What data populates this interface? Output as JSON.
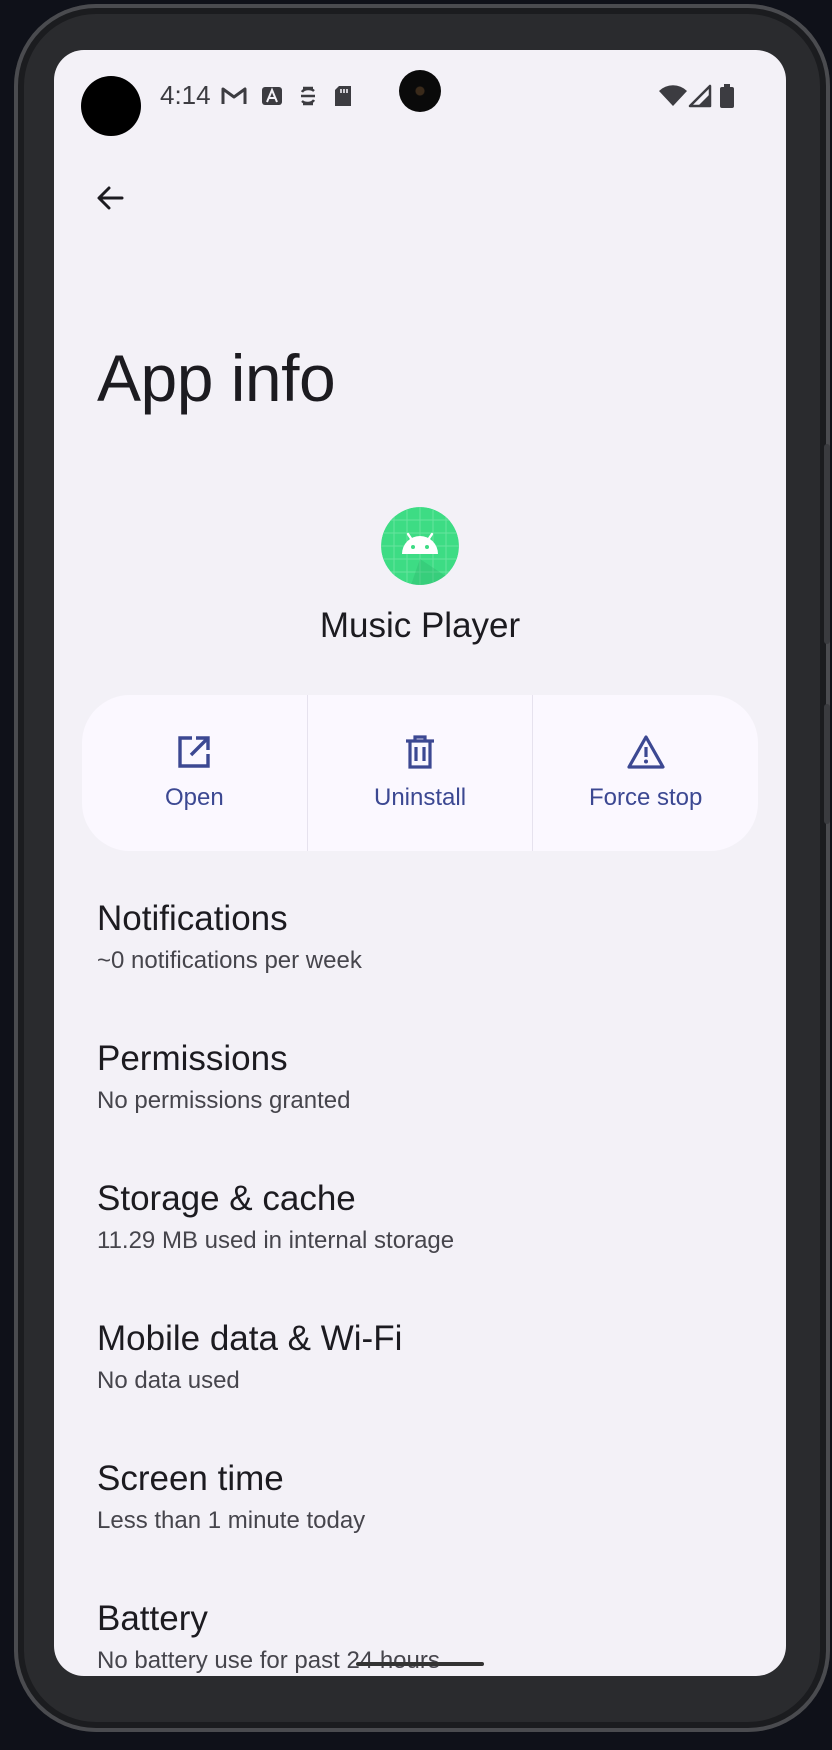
{
  "status_bar": {
    "time": "4:14",
    "left_icons": [
      "gmail-icon",
      "text-a-icon",
      "sync-icon",
      "sd-card-icon"
    ],
    "right_icons": [
      "wifi-icon",
      "signal-icon",
      "battery-icon"
    ]
  },
  "header": {
    "title": "App info"
  },
  "app": {
    "name": "Music Player",
    "icon": "android-icon",
    "icon_color": "#3ddc84"
  },
  "actions": [
    {
      "label": "Open",
      "icon": "open-external-icon"
    },
    {
      "label": "Uninstall",
      "icon": "trash-icon"
    },
    {
      "label": "Force stop",
      "icon": "warning-icon"
    }
  ],
  "settings": [
    {
      "title": "Notifications",
      "subtitle": "~0 notifications per week"
    },
    {
      "title": "Permissions",
      "subtitle": "No permissions granted"
    },
    {
      "title": "Storage & cache",
      "subtitle": "11.29 MB used in internal storage"
    },
    {
      "title": "Mobile data & Wi-Fi",
      "subtitle": "No data used"
    },
    {
      "title": "Screen time",
      "subtitle": "Less than 1 minute today"
    },
    {
      "title": "Battery",
      "subtitle": "No battery use for past 24 hours"
    }
  ],
  "colors": {
    "accent": "#3c4892",
    "background": "#f3f1f7",
    "card": "#fbf8ff"
  }
}
